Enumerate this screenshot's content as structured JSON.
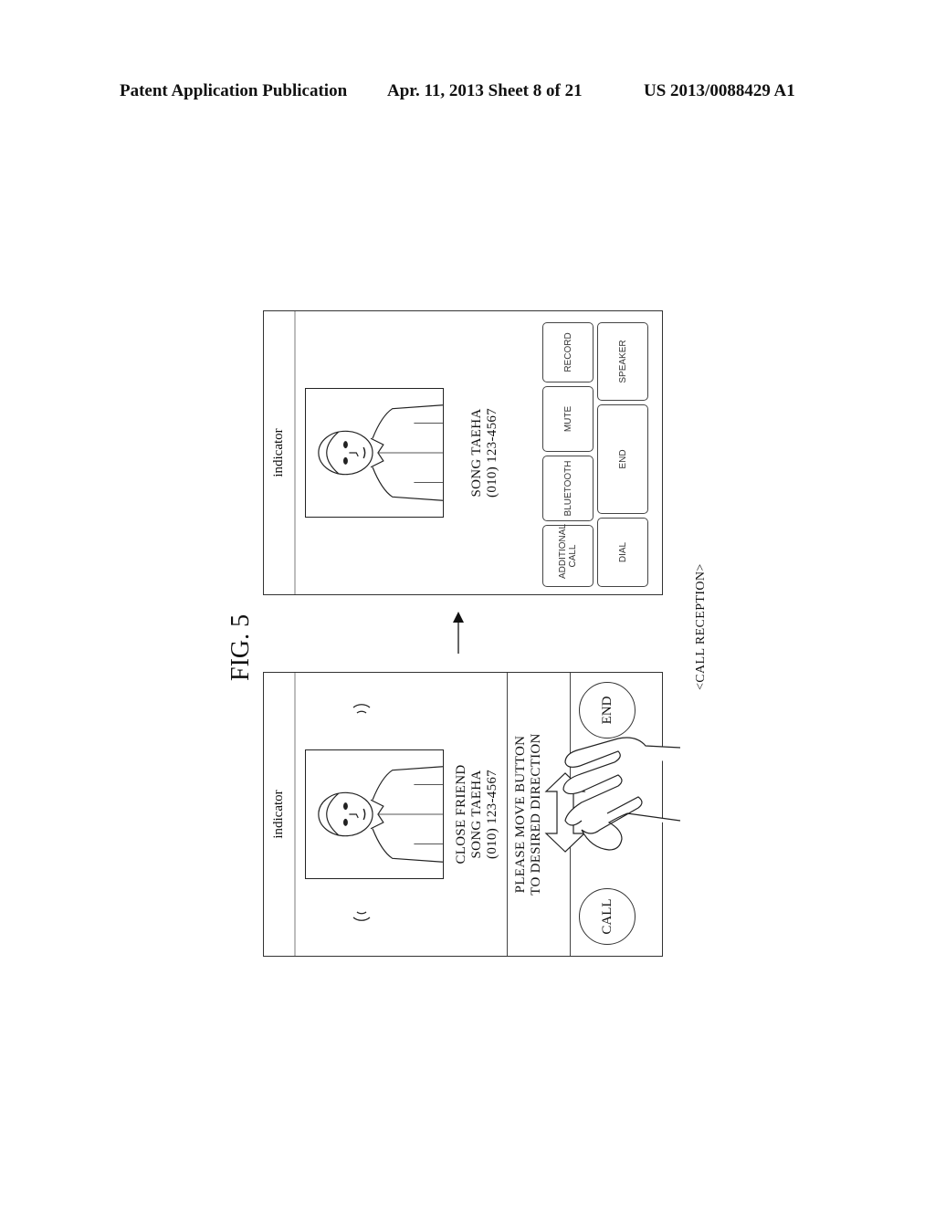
{
  "header": {
    "left": "Patent Application Publication",
    "middle": "Apr. 11, 2013  Sheet 8 of 21",
    "right": "US 2013/0088429 A1"
  },
  "figure": {
    "label": "FIG. 5",
    "caption": "<CALL RECEPTION>",
    "transition_arrow_icon": "arrow-right-icon"
  },
  "incoming_screen": {
    "indicator": "indicator",
    "caller_group": "CLOSE FRIEND",
    "caller_name": "SONG TAEHA",
    "caller_number": "(010) 123-4567",
    "instruction_line1": "PLEASE MOVE BUTTON",
    "instruction_line2": "TO DESIRED DIRECTION",
    "call_button": "CALL",
    "end_button": "END",
    "icons": [
      "ringing-wave-icon",
      "caller-photo",
      "double-arrow-icon",
      "hand-icon"
    ]
  },
  "in_call_screen": {
    "indicator": "indicator",
    "caller_name": "SONG TAEHA",
    "caller_number": "(010) 123-4567",
    "buttons_row1": [
      {
        "label": "ADDITIONAL CALL"
      },
      {
        "label": "BLUETOOTH"
      },
      {
        "label": "MUTE"
      },
      {
        "label": "RECORD"
      }
    ],
    "buttons_row2": [
      {
        "label": "DIAL"
      },
      {
        "label": "END"
      },
      {
        "label": "SPEAKER"
      }
    ]
  }
}
